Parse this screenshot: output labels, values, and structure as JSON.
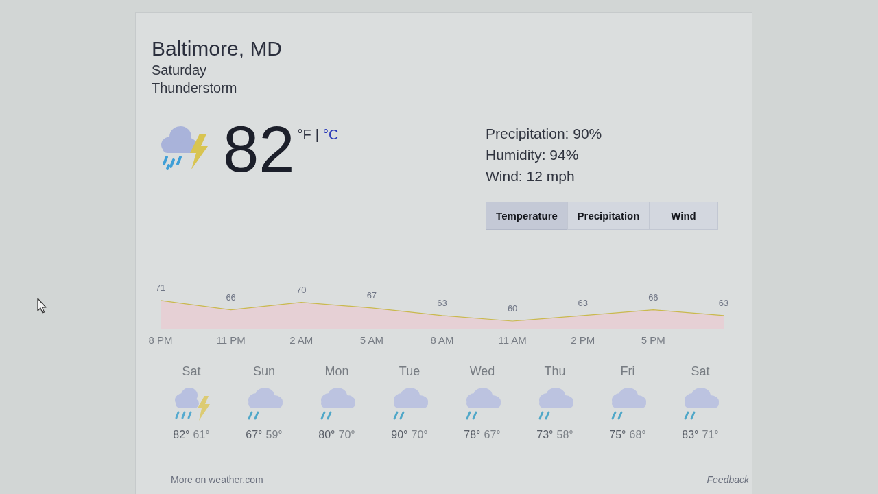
{
  "location": {
    "title": "Baltimore, MD",
    "day": "Saturday",
    "condition": "Thunderstorm"
  },
  "current": {
    "temperature": "82",
    "units": [
      {
        "label": "°F",
        "selected": true
      },
      {
        "label": "°C",
        "selected": false
      }
    ],
    "unit_separator": "|"
  },
  "details": [
    "Precipitation: 90%",
    "Humidity: 94%",
    "Wind: 12 mph"
  ],
  "tabs": [
    {
      "label": "Temperature",
      "selected": true
    },
    {
      "label": "Precipitation",
      "selected": false
    },
    {
      "label": "Wind",
      "selected": false
    }
  ],
  "chart_data": {
    "type": "area",
    "categories": [
      "8 PM",
      "11 PM",
      "2 AM",
      "5 AM",
      "8 AM",
      "11 AM",
      "2 PM",
      "5 PM",
      null
    ],
    "values": [
      71,
      66,
      70,
      67,
      63,
      60,
      63,
      66,
      63
    ],
    "color": "#c9b94e",
    "data_labels": true,
    "tick_labels": "x"
  },
  "days": [
    {
      "day": "Sat",
      "kind": "thunderstorm",
      "high": "82°",
      "low": "61°"
    },
    {
      "day": "Sun",
      "kind": "rain",
      "high": "67°",
      "low": "59°"
    },
    {
      "day": "Mon",
      "kind": "rain",
      "high": "80°",
      "low": "70°"
    },
    {
      "day": "Tue",
      "kind": "rain",
      "high": "90°",
      "low": "70°"
    },
    {
      "day": "Wed",
      "kind": "rain",
      "high": "78°",
      "low": "67°"
    },
    {
      "day": "Thu",
      "kind": "rain",
      "high": "73°",
      "low": "58°"
    },
    {
      "day": "Fri",
      "kind": "rain",
      "high": "75°",
      "low": "68°"
    },
    {
      "day": "Sat",
      "kind": "rain",
      "high": "83°",
      "low": "71°"
    }
  ],
  "footer": {
    "source_link": "More on weather.com",
    "feedback_link": "Feedback"
  }
}
